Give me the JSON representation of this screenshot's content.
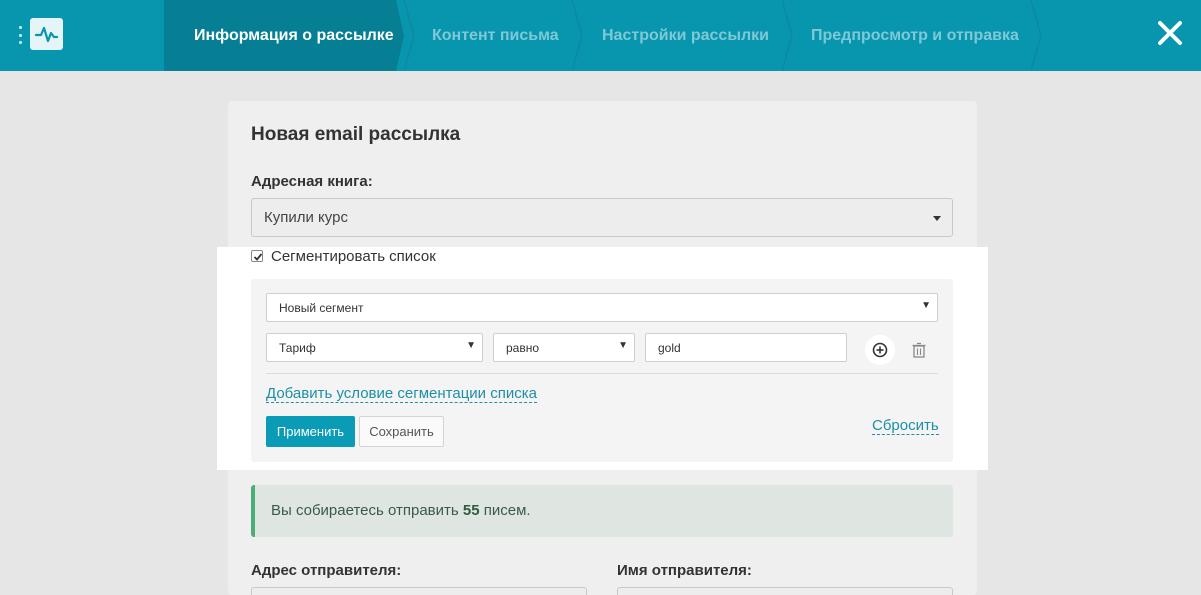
{
  "header": {
    "steps": [
      {
        "label": "Информация о рассылке",
        "active": true
      },
      {
        "label": "Контент письма",
        "active": false
      },
      {
        "label": "Настройки рассылки",
        "active": false
      },
      {
        "label": "Предпросмотр и отправка",
        "active": false
      }
    ],
    "close_icon": "close-icon",
    "logo_icon": "pulse-logo-icon",
    "menu_icon": "vertical-dots-icon"
  },
  "card": {
    "title": "Новая email рассылка",
    "address_book_label": "Адресная книга:",
    "address_book_value": "Купили курс",
    "segment_checkbox_label": "Сегментировать список",
    "segment_checked": true,
    "segment": {
      "segment_select_value": "Новый сегмент",
      "condition": {
        "field_value": "Тариф",
        "operator_value": "равно",
        "value": "gold"
      },
      "add_condition_link": "Добавить условие сегментации списка",
      "apply_button": "Применить",
      "save_button": "Сохранить",
      "reset_link": "Сбросить"
    },
    "alert": {
      "prefix": "Вы собираетесь отправить ",
      "count": "55",
      "suffix": " писем."
    },
    "sender_address_label": "Адрес отправителя:",
    "sender_name_label": "Имя отправителя:"
  },
  "colors": {
    "header_bg": "#0895ae",
    "header_active_bg": "#067f95",
    "primary_button": "#0a9bb6",
    "link": "#1e8fa6",
    "alert_border": "#4cae77"
  }
}
